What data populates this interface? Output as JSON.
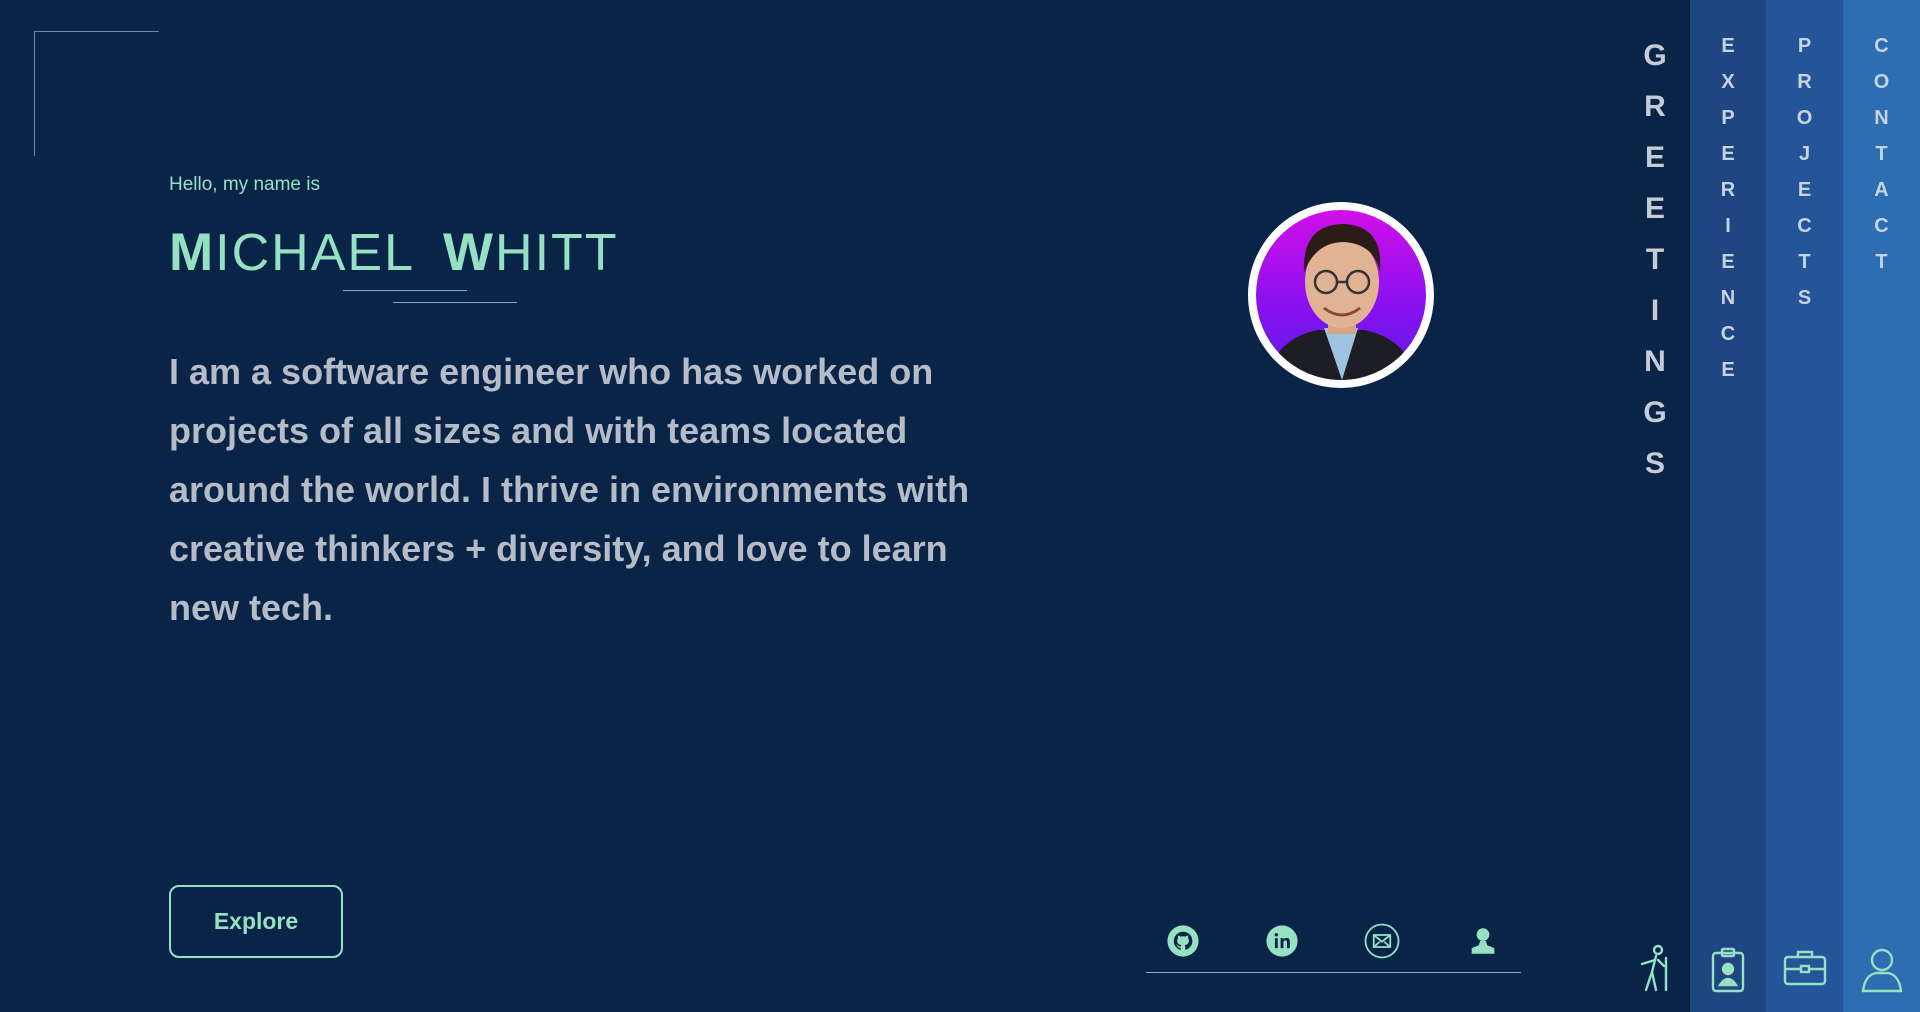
{
  "hero": {
    "greeting": "Hello, my name is",
    "first_cap": "M",
    "first_rest": "ICHAEL",
    "last_cap": "W",
    "last_rest": "HITT",
    "bio": "I am a software engineer who has worked on projects of all sizes and with teams located around the world. I thrive in environments with creative thinkers + diversity, and love to learn new tech."
  },
  "explore_button": "Explore",
  "social": [
    {
      "name": "github-icon"
    },
    {
      "name": "linkedin-icon"
    },
    {
      "name": "email-icon"
    },
    {
      "name": "person-icon"
    }
  ],
  "nav": {
    "greetings": [
      "G",
      "R",
      "E",
      "E",
      "T",
      "I",
      "N",
      "G",
      "S"
    ],
    "experience": [
      "E",
      "X",
      "P",
      "E",
      "R",
      "I",
      "E",
      "N",
      "C",
      "E"
    ],
    "projects": [
      "P",
      "R",
      "O",
      "J",
      "E",
      "C",
      "T",
      "S"
    ],
    "contact": [
      "C",
      "O",
      "N",
      "T",
      "A",
      "C",
      "T"
    ]
  },
  "colors": {
    "background": "#0a2447",
    "accent": "#96e0c4",
    "experience_panel": "#1f4680",
    "projects_panel": "#255599",
    "contact_panel": "#2d6db1"
  }
}
